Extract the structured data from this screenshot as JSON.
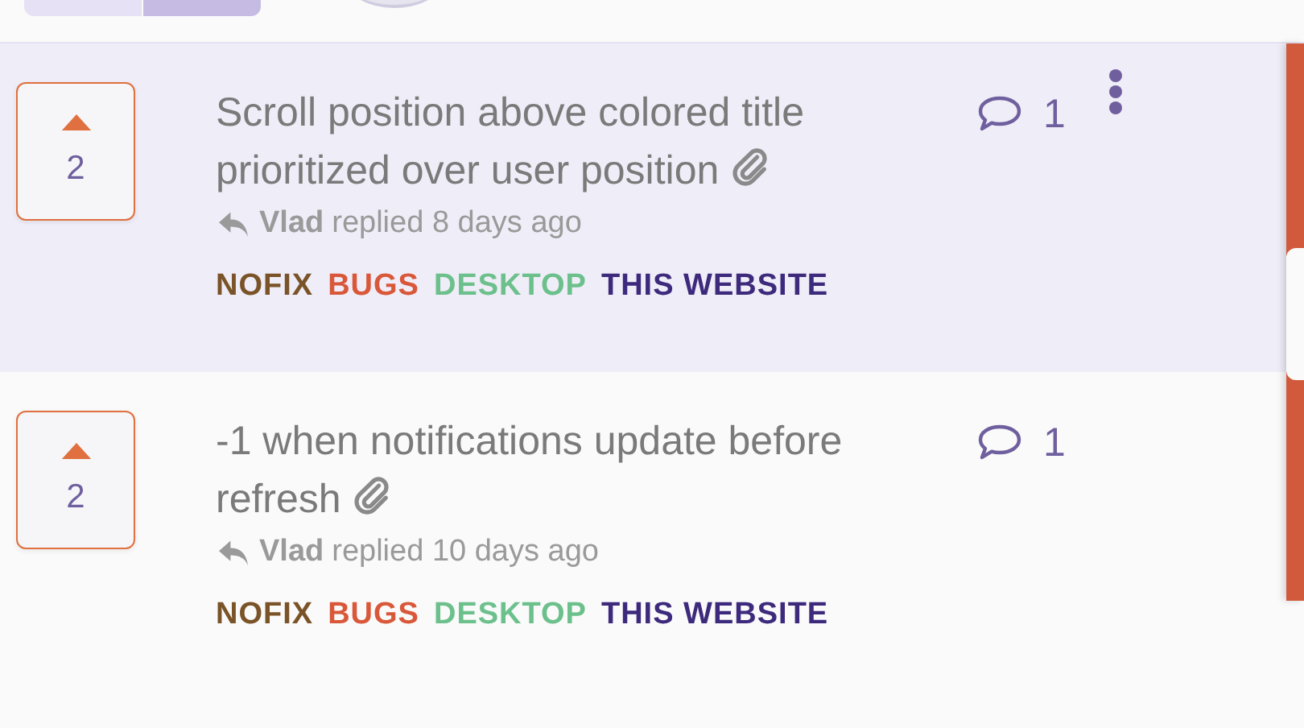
{
  "top_tabs": [
    {
      "selected": false
    },
    {
      "selected": true
    }
  ],
  "topics": [
    {
      "selected": true,
      "votes": "2",
      "title": "Scroll position above colored title prioritized over user position",
      "attachment": true,
      "user": "Vlad",
      "activity": "replied 8 days ago",
      "comments": "1",
      "tags": [
        {
          "label": "NOFIX",
          "color": "#7a5328"
        },
        {
          "label": "BUGS",
          "color": "#d9583a"
        },
        {
          "label": "DESKTOP",
          "color": "#6cc08c"
        },
        {
          "label": "THIS WEBSITE",
          "color": "#3d2a7c"
        }
      ]
    },
    {
      "selected": false,
      "votes": "2",
      "title": "-1 when notifications update before refresh",
      "attachment": true,
      "user": "Vlad",
      "activity": "replied 10 days ago",
      "comments": "1",
      "tags": [
        {
          "label": "NOFIX",
          "color": "#7a5328"
        },
        {
          "label": "BUGS",
          "color": "#d9583a"
        },
        {
          "label": "DESKTOP",
          "color": "#6cc08c"
        },
        {
          "label": "THIS WEBSITE",
          "color": "#3d2a7c"
        }
      ]
    }
  ]
}
